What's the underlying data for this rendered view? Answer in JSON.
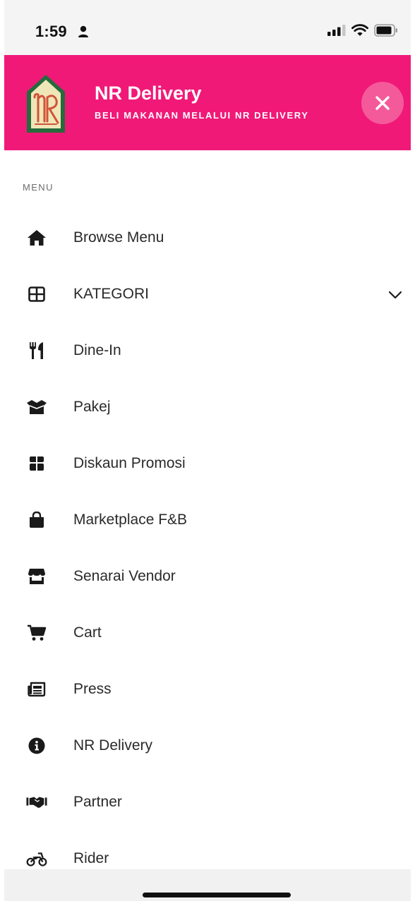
{
  "status_bar": {
    "time": "1:59",
    "icons": [
      "person-icon",
      "signal-icon",
      "wifi-icon",
      "battery-icon"
    ]
  },
  "header": {
    "title": "NR Delivery",
    "subtitle": "BELI MAKANAN MELALUI NR DELIVERY",
    "background_color": "#f01978",
    "close_button_color": "#f45a9a",
    "logo_color": "#d1523a",
    "logo_bg": "#efe6b8",
    "logo_frame": "#256b3b"
  },
  "menu": {
    "section_label": "MENU",
    "items": [
      {
        "label": "Browse Menu",
        "icon": "home-icon"
      },
      {
        "label": "KATEGORI",
        "icon": "grid-icon",
        "has_dropdown": true
      },
      {
        "label": "Dine-In",
        "icon": "utensils-icon"
      },
      {
        "label": "Pakej",
        "icon": "box-open-icon"
      },
      {
        "label": "Diskaun Promosi",
        "icon": "gift-icon"
      },
      {
        "label": "Marketplace F&B",
        "icon": "shopping-bag-icon"
      },
      {
        "label": "Senarai Vendor",
        "icon": "store-icon"
      },
      {
        "label": "Cart",
        "icon": "cart-icon"
      },
      {
        "label": "Press",
        "icon": "newspaper-icon"
      },
      {
        "label": "NR Delivery",
        "icon": "info-circle-icon"
      },
      {
        "label": "Partner",
        "icon": "handshake-icon"
      },
      {
        "label": "Rider",
        "icon": "motorcycle-icon"
      }
    ]
  }
}
